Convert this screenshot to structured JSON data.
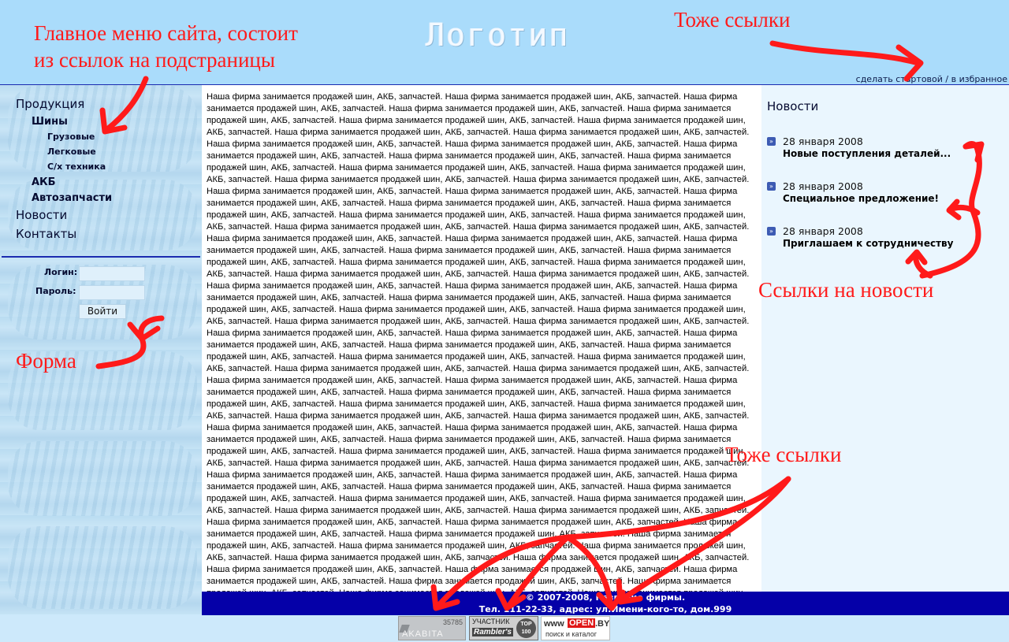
{
  "header": {
    "logo_text": "Логотип",
    "top_links": [
      "сделать стартовой",
      "в избранное"
    ],
    "top_links_separator": " / "
  },
  "sidebar": {
    "menu": [
      {
        "label": "Продукция",
        "level": 1
      },
      {
        "label": "Шины",
        "level": 2
      },
      {
        "label": "Грузовые",
        "level": 3
      },
      {
        "label": "Легковые",
        "level": 3
      },
      {
        "label": "С/х техника",
        "level": 3
      },
      {
        "label": "АКБ",
        "level": 2
      },
      {
        "label": "Автозапчасти",
        "level": 2
      },
      {
        "label": "Новости",
        "level": 1
      },
      {
        "label": "Контакты",
        "level": 1
      }
    ],
    "login_form": {
      "login_label": "Логин:",
      "password_label": "Пароль:",
      "login_value": "",
      "password_value": "",
      "submit_label": "Войти"
    }
  },
  "main": {
    "text": "Наша фирма занимается продажей шин, АКБ, запчастей. Наша фирма занимается продажей шин, АКБ, запчастей. Наша фирма занимается продажей шин, АКБ, запчастей. Наша фирма занимается продажей шин, АКБ, запчастей. Наша фирма занимается продажей шин, АКБ, запчастей. Наша фирма занимается продажей шин, АКБ, запчастей. Наша фирма занимается продажей шин, АКБ, запчастей. Наша фирма занимается продажей шин, АКБ, запчастей. Наша фирма занимается продажей шин, АКБ, запчастей. Наша фирма занимается продажей шин, АКБ, запчастей. Наша фирма занимается продажей шин, АКБ, запчастей. Наша фирма занимается продажей шин, АКБ, запчастей. Наша фирма занимается продажей шин, АКБ, запчастей. Наша фирма занимается продажей шин, АКБ, запчастей. Наша фирма занимается продажей шин, АКБ, запчастей. Наша фирма занимается продажей шин, АКБ, запчастей. Наша фирма занимается продажей шин, АКБ, запчастей. Наша фирма занимается продажей шин, АКБ, запчастей. Наша фирма занимается продажей шин, АКБ, запчастей. Наша фирма занимается продажей шин, АКБ, запчастей. Наша фирма занимается продажей шин, АКБ, запчастей. Наша фирма занимается продажей шин, АКБ, запчастей. Наша фирма занимается продажей шин, АКБ, запчастей. Наша фирма занимается продажей шин, АКБ, запчастей. Наша фирма занимается продажей шин, АКБ, запчастей. Наша фирма занимается продажей шин, АКБ, запчастей. Наша фирма занимается продажей шин, АКБ, запчастей. Наша фирма занимается продажей шин, АКБ, запчастей. Наша фирма занимается продажей шин, АКБ, запчастей. Наша фирма занимается продажей шин, АКБ, запчастей. Наша фирма занимается продажей шин, АКБ, запчастей. Наша фирма занимается продажей шин, АКБ, запчастей. Наша фирма занимается продажей шин, АКБ, запчастей. Наша фирма занимается продажей шин, АКБ, запчастей. Наша фирма занимается продажей шин, АКБ, запчастей. Наша фирма занимается продажей шин, АКБ, запчастей. Наша фирма занимается продажей шин, АКБ, запчастей. Наша фирма занимается продажей шин, АКБ, запчастей. Наша фирма занимается продажей шин, АКБ, запчастей. Наша фирма занимается продажей шин, АКБ, запчастей. Наша фирма занимается продажей шин, АКБ, запчастей. Наша фирма занимается продажей шин, АКБ, запчастей. Наша фирма занимается продажей шин, АКБ, запчастей. Наша фирма занимается продажей шин, АКБ, запчастей. Наша фирма занимается продажей шин, АКБ, запчастей. Наша фирма занимается продажей шин, АКБ, запчастей. Наша фирма занимается продажей шин, АКБ, запчастей. Наша фирма занимается продажей шин, АКБ, запчастей. Наша фирма занимается продажей шин, АКБ, запчастей. Наша фирма занимается продажей шин, АКБ, запчастей. Наша фирма занимается продажей шин, АКБ, запчастей. Наша фирма занимается продажей шин, АКБ, запчастей. Наша фирма занимается продажей шин, АКБ, запчастей. Наша фирма занимается продажей шин, АКБ, запчастей. Наша фирма занимается продажей шин, АКБ, запчастей. Наша фирма занимается продажей шин, АКБ, запчастей. Наша фирма занимается продажей шин, АКБ, запчастей. Наша фирма занимается продажей шин, АКБ, запчастей. Наша фирма занимается продажей шин, АКБ, запчастей. Наша фирма занимается продажей шин, АКБ, запчастей. Наша фирма занимается продажей шин, АКБ, запчастей. Наша фирма занимается продажей шин, АКБ, запчастей. Наша фирма занимается продажей шин, АКБ, запчастей. Наша фирма занимается продажей шин, АКБ, запчастей. Наша фирма занимается продажей шин, АКБ, запчастей. Наша фирма занимается продажей шин, АКБ, запчастей. Наша фирма занимается продажей шин, АКБ, запчастей. Наша фирма занимается продажей шин, АКБ, запчастей. Наша фирма занимается продажей шин, АКБ, запчастей. Наша фирма занимается продажей шин, АКБ, запчастей. Наша фирма занимается продажей шин, АКБ, запчастей. Наша фирма занимается продажей шин, АКБ, запчастей. Наша фирма занимается продажей шин, АКБ, запчастей. Наша фирма занимается продажей шин, АКБ, запчастей. Наша фирма занимается продажей шин, АКБ, запчастей. Наша фирма занимается продажей шин, АКБ, запчастей. Наша фирма занимается продажей шин, АКБ, запчастей. Наша фирма занимается продажей шин, АКБ, запчастей. Наша фирма занимается продажей шин, АКБ, запчастей. Наша фирма занимается продажей шин, АКБ, запчастей. Наша фирма занимается продажей шин, АКБ, запчастей. Наша фирма занимается продажей шин, АКБ, запчастей. Наша фирма занимается продажей шин, АКБ, запчастей. Наша фирма занимается продажей шин, АКБ, запчастей. Наша фирма занимается продажей шин, АКБ, запчастей. Наша фирма занимается продажей шин, АКБ, запчастей. Наша фирма занимается продажей шин, АКБ, запчастей. Наша фирма занимается продажей шин, АКБ, запчастей. Наша фирма занимается продажей шин, АКБ, запчастей. Наша фирма занимается продажей шин, АКБ, запчастей. Наша фирма занимается продажей шин, АКБ, запчастей. Наша фирма занимается продажей шин, АКБ, запчастей. Наша фирма занимается продажей шин, АКБ, запчастей. Наша фирма занимается продажей шин, АКБ, запчастей. Наша фирма занимается продажей шин, АКБ, запчастей. Наша фирма занимается продажей шин, АКБ, запчастей. Наша фирма занимается продажей шин, АКБ, запчастей. Наша фирма занимается продажей шин, АКБ, запчастей. Наша фирма занимается продажей шин, АКБ, запчастей. Наша фирма занимается продажей шин, АКБ, запчастей. Наша фирма занимается продажей шин, АКБ, запчастей. Наша фирма занимается продажей шин, АКБ, запчастей. Наша фирма занимается продажей шин, АКБ, запчастей. Наша фирма занимается продажей шин, АКБ, запчастей. Наша фирма занимается продажей шин, АКБ, запчастей. Наша фирма занимается продажей шин, АКБ, запчастей. Наша фирма занимается продажей шин, АКБ, запчастей. Наша фирма занимается продажей шин, АКБ, запчастей."
  },
  "news": {
    "title": "Новости",
    "items": [
      {
        "date": "28 января 2008",
        "title": "Новые поступления деталей..."
      },
      {
        "date": "28 января 2008",
        "title": "Специальное предложение!"
      },
      {
        "date": "28 января 2008",
        "title": "Приглашаем к сотрудничеству"
      }
    ]
  },
  "footer": {
    "copyright": "© 2007-2008, Название фирмы.",
    "address": "Тел. 111-22-33, адрес: ул.Имени-кого-то, дом.999"
  },
  "counters": {
    "akavita_number": "35785",
    "akavita_label": "AKABITA",
    "rambler_line1": "УЧАСТНИК",
    "rambler_line2": "Rambler's",
    "rambler_badge": "TOP 100",
    "openby_prefix": "www",
    "openby_brand": "OPEN",
    "openby_suffix": ".BY",
    "openby_sub": "поиск и каталог"
  },
  "annotations": {
    "main_menu": "Главное меню сайта, состоит",
    "main_menu_line2": "из ссылок на подстраницы",
    "top_links": "Тоже ссылки",
    "form": "Форма",
    "news_links": "Ссылки на новости",
    "bottom_links": "Тоже ссылки"
  },
  "colors": {
    "header_bg": "#aadcfb",
    "footer_bg": "#0500a8",
    "annotation": "#ff1a1a"
  }
}
